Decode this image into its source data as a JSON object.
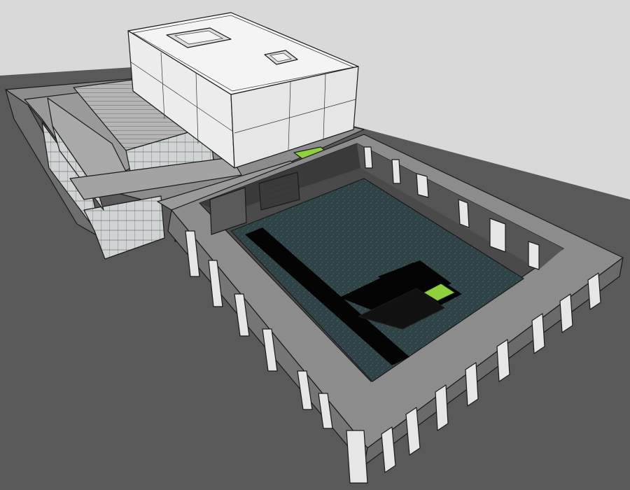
{
  "scene": {
    "colors": {
      "sky": "#d9d9d9",
      "ground": "#595959",
      "roof_white": "#f4f4f4",
      "wall_white": "#e6e6e6",
      "concrete_light": "#a9a9a9",
      "concrete_mid": "#8c8c8c",
      "concrete_dark": "#6e6e6e",
      "glass": "#cfd3d3",
      "water": "#2f4347",
      "water_highlight": "#46646a",
      "deep_void": "#040404",
      "green_patch": "#8fd13b",
      "edge": "#1a1a1a"
    },
    "objects": [
      "ground-plane",
      "white-volume-building",
      "roof-skylight",
      "striped-roof-hall",
      "glazed-lower-block",
      "colonnade-courtyard",
      "reflecting-pool",
      "black-channel",
      "green-lawn-square"
    ]
  }
}
